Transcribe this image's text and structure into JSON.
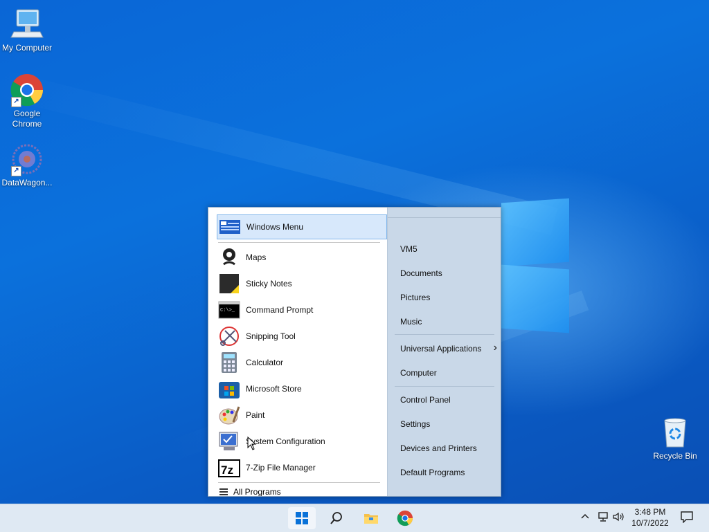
{
  "desktop": {
    "icons": [
      {
        "label": "My Computer"
      },
      {
        "label": "Google Chrome"
      },
      {
        "label": "DataWagon..."
      },
      {
        "label": "Recycle Bin"
      }
    ]
  },
  "start_menu": {
    "pinned": [
      {
        "label": "Windows Menu",
        "icon": "windows-menu-icon"
      },
      {
        "label": "Maps",
        "icon": "maps-icon"
      },
      {
        "label": "Sticky Notes",
        "icon": "sticky-notes-icon"
      },
      {
        "label": "Command Prompt",
        "icon": "command-prompt-icon"
      },
      {
        "label": "Snipping Tool",
        "icon": "snipping-tool-icon"
      },
      {
        "label": "Calculator",
        "icon": "calculator-icon"
      },
      {
        "label": "Microsoft Store",
        "icon": "microsoft-store-icon"
      },
      {
        "label": "Paint",
        "icon": "paint-icon"
      },
      {
        "label": "System Configuration",
        "icon": "system-configuration-icon"
      },
      {
        "label": "7-Zip File Manager",
        "icon": "7zip-icon"
      }
    ],
    "all_programs": "All Programs",
    "cmd_text": "C:\\>_",
    "zip_text": "7z",
    "right": [
      {
        "label": "VM5"
      },
      {
        "label": "Documents"
      },
      {
        "label": "Pictures"
      },
      {
        "label": "Music"
      },
      {
        "label": "Universal Applications"
      },
      {
        "label": "Computer"
      },
      {
        "label": "Control Panel"
      },
      {
        "label": "Settings"
      },
      {
        "label": "Devices and Printers"
      },
      {
        "label": "Default Programs"
      }
    ],
    "submenu_arrow": "›"
  },
  "taskbar": {
    "time": "3:48 PM",
    "date": "10/7/2022"
  },
  "colors": {
    "desktop": "#0a66d6",
    "menu_right_bg": "#c9d8e8",
    "selection": "#d7e8fb",
    "taskbar": "#dfe9f3"
  }
}
